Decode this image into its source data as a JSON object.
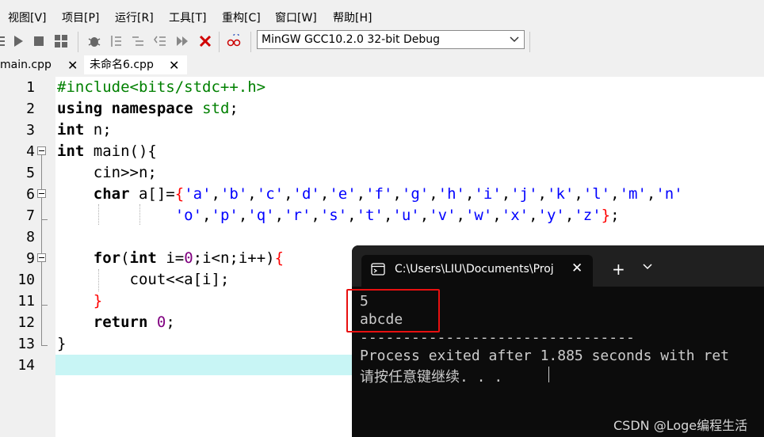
{
  "menu": [
    "视图[V]",
    "项目[P]",
    "运行[R]",
    "工具[T]",
    "重构[C]",
    "窗口[W]",
    "帮助[H]"
  ],
  "toolbar": {
    "compiler": "MinGW GCC10.2.0 32-bit Debug"
  },
  "tabs": [
    {
      "label": "main.cpp",
      "close": "✕"
    },
    {
      "label": "未命名6.cpp",
      "close": "✕"
    }
  ],
  "editor": {
    "line_numbers": [
      "1",
      "2",
      "3",
      "4",
      "5",
      "6",
      "7",
      "8",
      "9",
      "10",
      "11",
      "12",
      "13",
      "14"
    ]
  },
  "terminal": {
    "title": "C:\\Users\\LIU\\Documents\\Proj",
    "close": "✕",
    "plus": "+",
    "dropdown": "⌄",
    "lines": [
      "5",
      "abcde",
      "--------------------------------",
      "Process exited after 1.885 seconds with ret",
      "请按任意键继续. . ."
    ]
  },
  "watermark": "CSDN @Loge编程生活",
  "colors": {
    "keyword": "#000000",
    "preprocessor": "#008000",
    "string": "#0000ff",
    "number": "#800080",
    "brace": "#ff0000",
    "current_line": "#c8f5f5",
    "terminal_bg": "#0c0c0c",
    "highlight_box": "#e81010"
  }
}
